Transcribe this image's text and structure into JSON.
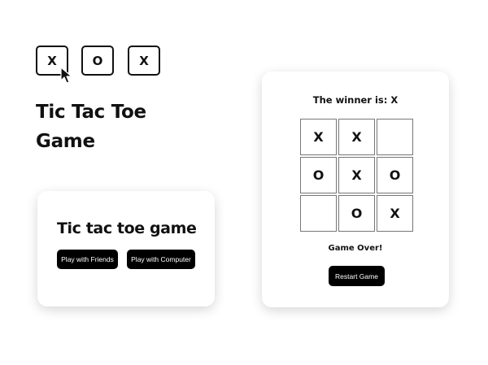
{
  "header_tiles": [
    "X",
    "O",
    "X"
  ],
  "hero": {
    "title_line1": "Tic Tac Toe",
    "title_line2": "Game"
  },
  "menu_card": {
    "title": "Tic tac toe game",
    "play_friends_label": "Play with Friends",
    "play_computer_label": "Play with Computer"
  },
  "game_card": {
    "winner_text": "The winner is: X",
    "board": [
      "X",
      "X",
      "",
      "O",
      "X",
      "O",
      "",
      "O",
      "X"
    ],
    "status_text": "Game Over!",
    "restart_label": "Restart Game"
  },
  "icons": {
    "cursor": "mouse-pointer-icon"
  },
  "colors": {
    "button_bg": "#000000",
    "button_text": "#ffffff",
    "text": "#111111",
    "page_bg": "#ffffff"
  }
}
